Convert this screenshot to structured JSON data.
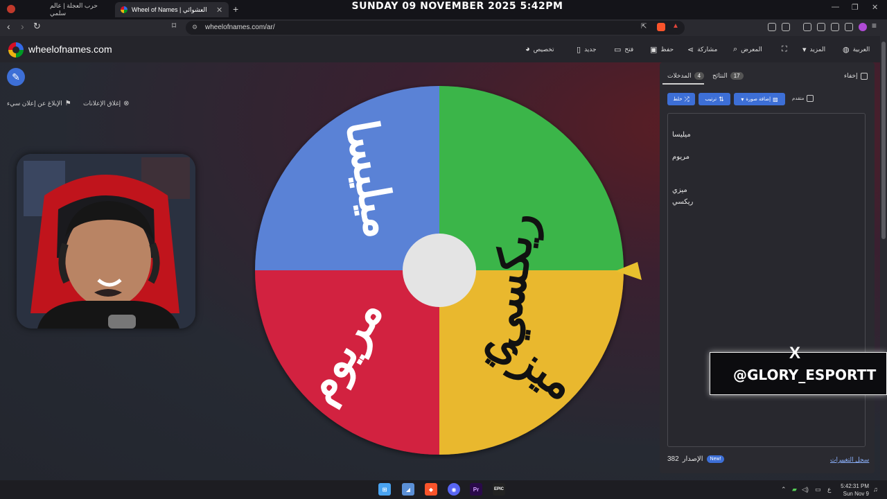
{
  "browser": {
    "tabs": [
      {
        "label": "حرب العجلة | عالم سلمي"
      },
      {
        "label": "Wheel of Names | عجلة الاختيار العشوائي"
      }
    ],
    "new_tab": "+",
    "datetime": "SUNDAY 09 NOVEMBER 2025 5:42PM",
    "url": "wheelofnames.com/ar/"
  },
  "site": {
    "name": "wheelofnames.com",
    "menu": {
      "customize": "تخصيص",
      "new": "جديد",
      "open": "فتح",
      "save": "حفظ",
      "share": "مشاركة",
      "gallery": "المعرض",
      "more": "المزيد",
      "language": "العربية"
    },
    "ads": {
      "close_ads": "إغلاق الإعلانات",
      "report_ad": "الإبلاغ عن إعلان سيء"
    }
  },
  "wheel": {
    "segments": [
      {
        "label": "ريكسي",
        "color": "#3ab54a"
      },
      {
        "label": "ميزي",
        "color": "#e9b82f"
      },
      {
        "label": "مريوم",
        "color": "#d2213f"
      },
      {
        "label": "ميليسا",
        "color": "#5a82d6"
      }
    ],
    "center_color": "#e4e4e4",
    "pointer_color": "#e8c12e"
  },
  "panel": {
    "hide_label": "إخفاء",
    "tabs": [
      {
        "label": "المدخلات",
        "count": "4"
      },
      {
        "label": "النتائج",
        "count": "17"
      }
    ],
    "toolbar": {
      "shuffle": "خلط",
      "sort": "ترتيب",
      "add_image": "إضافة صورة",
      "advanced": "متقدم"
    },
    "entries": [
      "ميليسا",
      "مريوم",
      "ميزي",
      "ريكسي"
    ],
    "version_label": "الإصدار",
    "version_number": "382",
    "new_badge": "New!",
    "changelog": "سجل التغييرات"
  },
  "overlay": {
    "x_logo": "X",
    "handle": "@GLORY_ESPORTT"
  },
  "taskbar": {
    "premiere": "Pr",
    "epic": "EPIC",
    "time": "5:42:31 PM",
    "date": "Sun Nov 9",
    "lang": "ع"
  }
}
